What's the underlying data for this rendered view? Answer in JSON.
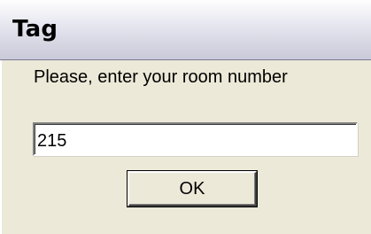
{
  "dialog": {
    "title": "Tag",
    "prompt": "Please, enter your room number",
    "input_value": "215",
    "ok_label": "OK"
  }
}
